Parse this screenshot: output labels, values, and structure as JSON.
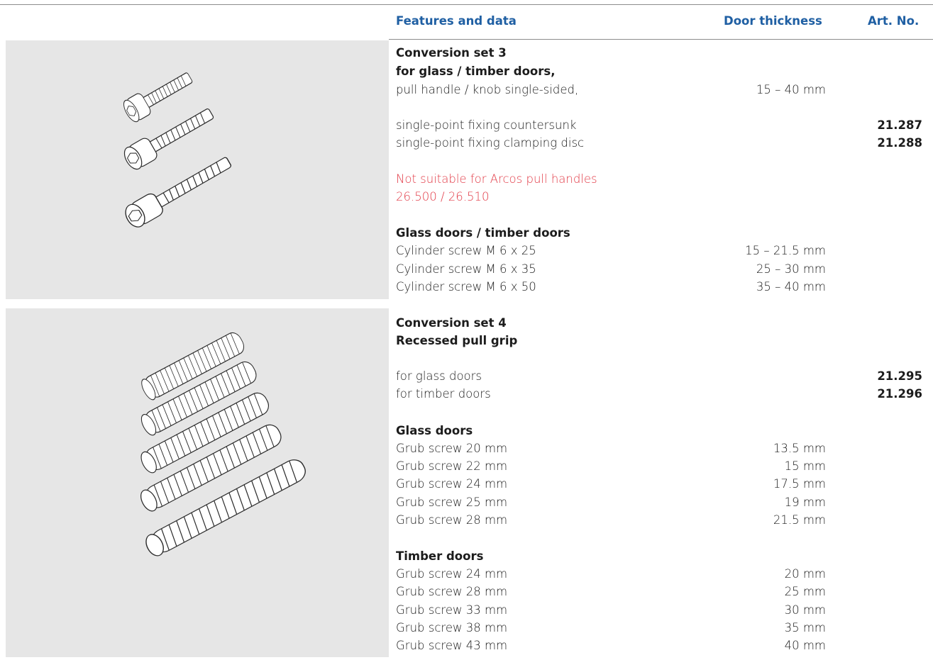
{
  "header": {
    "features": "Features and data",
    "door_thickness": "Door thickness",
    "art_no": "Art. No."
  },
  "set3": {
    "title": "Conversion set 3",
    "subtitle": "for glass / timber doors,",
    "line": "pull handle / knob single-sided,",
    "line_thickness": "15 – 40 mm",
    "options": [
      {
        "label": "single-point fixing countersunk",
        "art": "21.287"
      },
      {
        "label": "single-point fixing clamping disc",
        "art": "21.288"
      }
    ],
    "warning_line1": "Not suitable for Arcos pull handles",
    "warning_line2": "26.500 / 26.510",
    "group_title": "Glass doors / timber doors",
    "screws": [
      {
        "label": "Cylinder screw M 6 x 25",
        "thickness": "15 – 21.5 mm"
      },
      {
        "label": "Cylinder screw M 6 x 35",
        "thickness": "25 – 30 mm"
      },
      {
        "label": "Cylinder screw M 6 x 50",
        "thickness": "35 – 40 mm"
      }
    ]
  },
  "set4": {
    "title": "Conversion set 4",
    "subtitle": "Recessed pull grip",
    "options": [
      {
        "label": "for glass doors",
        "art": "21.295"
      },
      {
        "label": "for timber doors",
        "art": "21.296"
      }
    ],
    "glass_title": "Glass doors",
    "glass": [
      {
        "label": "Grub screw 20 mm",
        "thickness": "13.5 mm"
      },
      {
        "label": "Grub screw 22 mm",
        "thickness": "15 mm"
      },
      {
        "label": "Grub screw 24 mm",
        "thickness": "17.5 mm"
      },
      {
        "label": "Grub screw 25 mm",
        "thickness": "19 mm"
      },
      {
        "label": "Grub screw 28 mm",
        "thickness": "21.5 mm"
      }
    ],
    "timber_title": "Timber doors",
    "timber": [
      {
        "label": "Grub screw 24 mm",
        "thickness": "20 mm"
      },
      {
        "label": "Grub screw 28 mm",
        "thickness": "25 mm"
      },
      {
        "label": "Grub screw 33 mm",
        "thickness": "30 mm"
      },
      {
        "label": "Grub screw 38 mm",
        "thickness": "35 mm"
      },
      {
        "label": "Grub screw 43 mm",
        "thickness": "40 mm"
      }
    ]
  },
  "colors": {
    "header_blue": "#1f5fa3",
    "warning_red": "#e23b47",
    "panel_grey": "#e6e6e6"
  },
  "icons": {
    "set3_image": "cylinder-screws-icon",
    "set4_image": "grub-screws-icon"
  }
}
